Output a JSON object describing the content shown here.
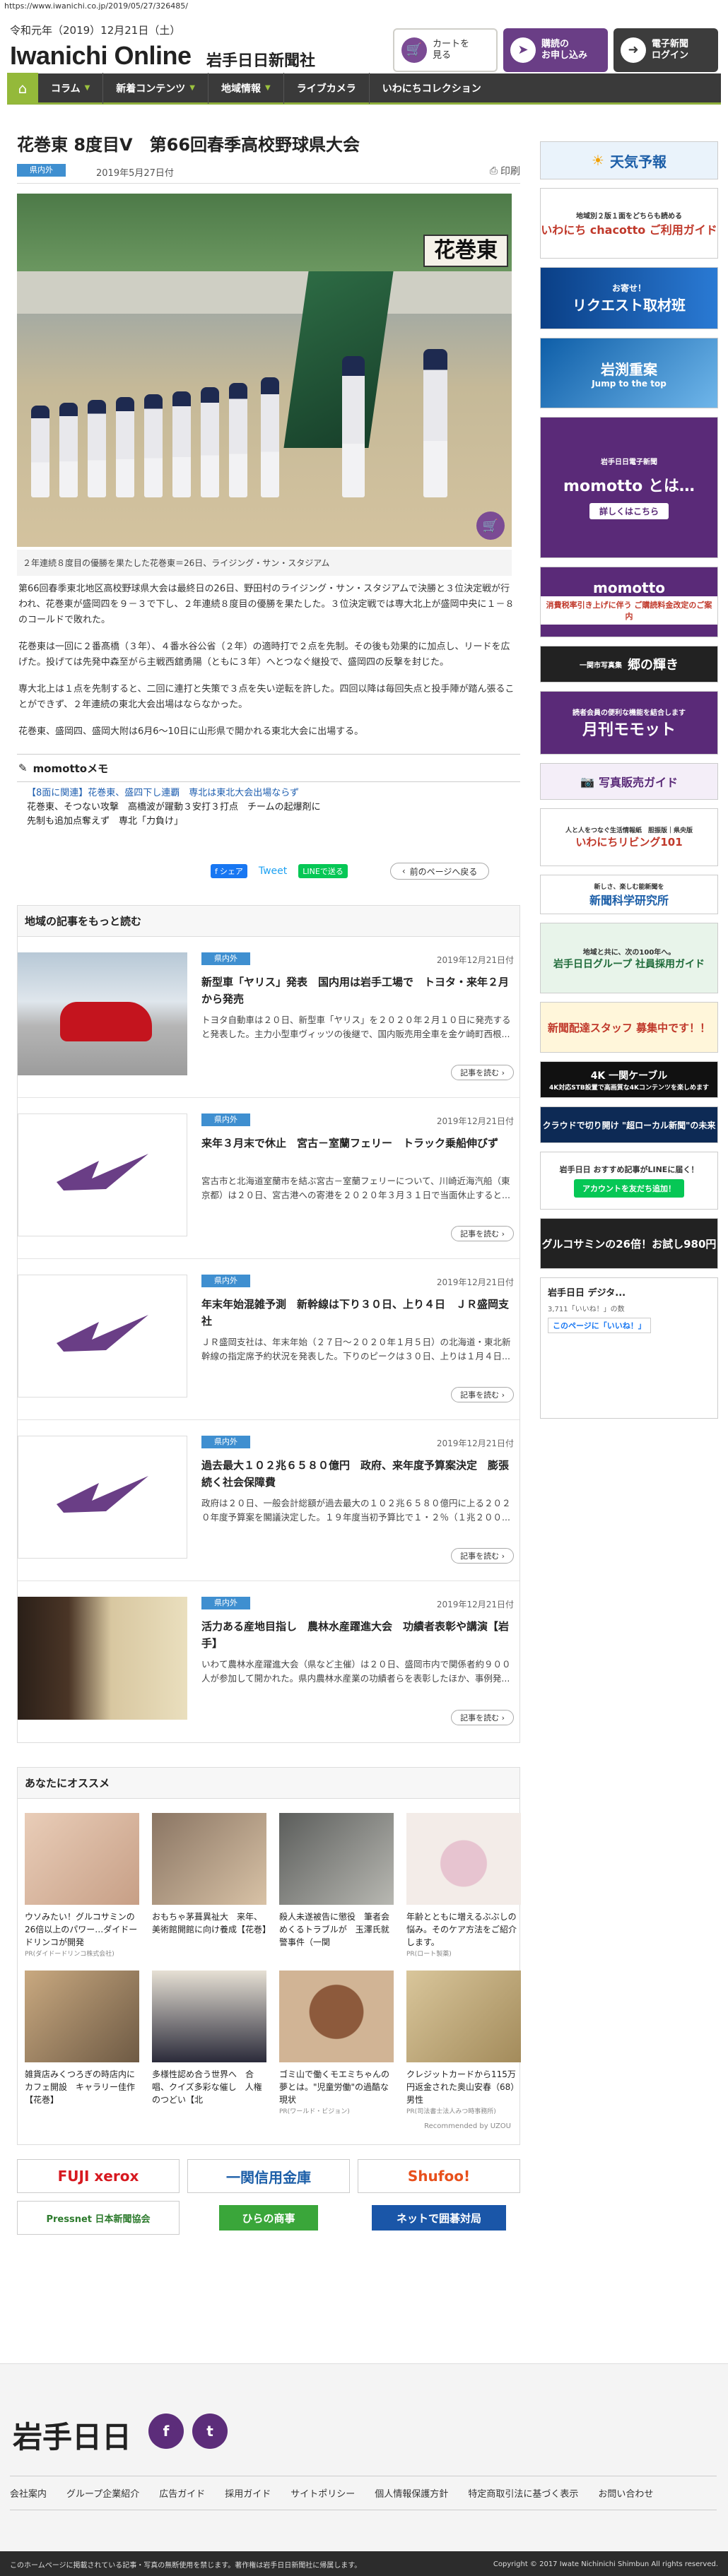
{
  "url": "https://www.iwanichi.co.jp/2019/05/27/326485/",
  "header": {
    "date": "令和元年（2019）12月21日（土）",
    "site_name": "Iwanichi Online",
    "site_sub": "岩手日日新聞社",
    "cart_label": "カートを\n見る",
    "subscribe_label": "購読の\nお申し込み",
    "epaper_label": "電子新聞\nログイン"
  },
  "nav": [
    "コラム",
    "新着コンテンツ",
    "地域情報",
    "ライブカメラ",
    "いわにちコレクション"
  ],
  "article": {
    "title": "花巻東 8度目V　第66回春季高校野球県大会",
    "category": "県内外",
    "published": "2019年5月27日付",
    "print_label": "印刷",
    "photo_sign": "花巻東",
    "caption": "２年連続８度目の優勝を果たした花巻東＝26日、ライジング・サン・スタジアム",
    "paragraphs": [
      "第66回春季東北地区高校野球県大会は最終日の26日、野田村のライジング・サン・スタジアムで決勝と３位決定戦が行われ、花巻東が盛岡四を９－３で下し、２年連続８度目の優勝を果たした。３位決定戦では専大北上が盛岡中央に１－８のコールドで敗れた。",
      "花巻東は一回に２番髙橋（３年）、４番水谷公省（２年）の適時打で２点を先制。その後も効果的に加点し、リードを広げた。投げては先発中森至がら主戦西舘勇陽（ともに３年）へとつなぐ継投で、盛岡四の反撃を封じた。",
      "専大北上は１点を先制すると、二回に連打と失策で３点を失い逆転を許した。四回以降は毎回失点と投手陣が踏ん張ることができず、２年連続の東北大会出場はならなかった。",
      "花巻東、盛岡四、盛岡大附は6月6～10日に山形県で開かれる東北大会に出場する。"
    ]
  },
  "memo": {
    "title": "momottoメモ",
    "lines": [
      "【8面に関連】花巻東、盛四下し連覇　専北は東北大会出場ならず",
      "花巻東、そつない攻撃　高橋波が躍動３安打３打点　チームの起爆剤に",
      "先制も追加点奪えず　専北「力負け」"
    ]
  },
  "share": {
    "facebook": "シェア",
    "twitter": "Tweet",
    "line": "LINEで送る",
    "back": "前のページへ戻る"
  },
  "local_news": {
    "heading": "地域の記事をもっと読む",
    "more_label": "記事を読む",
    "items": [
      {
        "tag": "県内外",
        "date": "2019年12月21日付",
        "title": "新型車「ヤリス」発表　国内用は岩手工場で　トヨタ・来年２月から発売",
        "summary": "トヨタ自動車は２０日、新型車「ヤリス」を２０２０年２月１０日に発売すると発表した。主力小型車ヴィッツの後継で、国内販売用全車を金ケ崎町西根..."
      },
      {
        "tag": "県内外",
        "date": "2019年12月21日付",
        "title": "来年３月末で休止　宮古－室蘭フェリー　トラック乗船伸びず",
        "summary": "宮古市と北海道室蘭市を結ぶ宮古－室蘭フェリーについて、川崎近海汽船（東京都）は２０日、宮古港への寄港を２０２０年３月３１日で当面休止すると..."
      },
      {
        "tag": "県内外",
        "date": "2019年12月21日付",
        "title": "年末年始混雑予測　新幹線は下り３０日、上り４日　ＪＲ盛岡支社",
        "summary": "ＪＲ盛岡支社は、年末年始（２７日～２０２０年１月５日）の北海道・東北新幹線の指定席予約状況を発表した。下りのピークは３０日、上りは１月４日..."
      },
      {
        "tag": "県内外",
        "date": "2019年12月21日付",
        "title": "過去最大１０２兆６５８０億円　政府、来年度予算案決定　膨張続く社会保障費",
        "summary": "政府は２０日、一般会計総額が過去最大の１０２兆６５８０億円に上る２０２０年度予算案を閣議決定した。１９年度当初予算比で１・２％（１兆２００..."
      },
      {
        "tag": "県内外",
        "date": "2019年12月21日付",
        "title": "活力ある産地目指し　農林水産躍進大会　功績者表彰や講演【岩手】",
        "summary": "いわて農林水産躍進大会（県など主催）は２０日、盛岡市内で関係者約９００人が参加して開かれた。県内農林水産業の功績者らを表彰したほか、事例発..."
      }
    ]
  },
  "recommend": {
    "heading": "あなたにオススメ",
    "by": "Recommended by UZOU",
    "items": [
      {
        "title": "ウソみたい！グルコサミンの26倍以上のパワー…ダイドードリンコが開発",
        "pr": "PR(ダイドードリンコ株式会社)"
      },
      {
        "title": "おもちゃ茅葺異祉大　来年、美術館開館に向け養成【花巻】",
        "pr": ""
      },
      {
        "title": "殺人未遂被告に懲役　筆者会めくるトラブルが　玉澤氏就警事件（一関",
        "pr": ""
      },
      {
        "title": "年齢とともに増えるぶぶしの悩み。そのケア方法をご紹介します。",
        "pr": "PR(ロート製薬)"
      },
      {
        "title": "雑貨店みくつろぎの時店内にカフェ開設　キャラリー佳作【花巻】",
        "pr": ""
      },
      {
        "title": "多様性認め合う世界へ　合唱、クイズ多彩な催し　人権のつどい【北",
        "pr": ""
      },
      {
        "title": "ゴミ山で働くモエミちゃんの夢とは。\"児童労働\"の過酷な現状",
        "pr": "PR(ワールド・ビジョン)"
      },
      {
        "title": "クレジットカードから115万円返金された奥山安春（68）男性",
        "pr": "PR(司法書士法人みつ時事務所)"
      }
    ]
  },
  "banners": [
    "FUJI xerox",
    "一関信用金庫",
    "Shufoo!",
    "Pressnet 日本新聞協会",
    "ひらの商事",
    "ネットで囲碁対局"
  ],
  "sidebar": [
    {
      "text": "天気予報",
      "sub": ""
    },
    {
      "text": "いわにち chacotto ご利用ガイド",
      "sub": "地域別２版１面をどちらも読める"
    },
    {
      "text": "リクエスト取材班",
      "sub": "お寄せ！"
    },
    {
      "text": "岩渕重案",
      "sub": "Jump to the top"
    },
    {
      "text": "momotto とは…",
      "sub": "岩手日日電子新聞"
    },
    {
      "text": "詳しくはこちら",
      "sub": ""
    },
    {
      "text": "momotto",
      "sub": "消費税率引き上げに伴う ご購読料金改定のご案内"
    },
    {
      "text": "郷の輝き",
      "sub": "一関市写真集"
    },
    {
      "text": "月刊モモット",
      "sub": "読者会員の便利な機能を結合します"
    },
    {
      "text": "写真販売ガイド",
      "sub": ""
    },
    {
      "text": "いわにちリビング101",
      "sub": "人と人をつなぐ生活情報紙　胆振版｜県央版"
    },
    {
      "text": "新聞科学研究所",
      "sub": "新しさ、楽しむ能新聞を"
    },
    {
      "text": "岩手日日グループ 社員採用ガイド",
      "sub": "地域と共に、次の100年へ。"
    },
    {
      "text": "新聞配達スタッフ 募集中です！！",
      "sub": ""
    },
    {
      "text": "4K 一関ケーブル",
      "sub": "4K対応STB設置で高画質な4Kコンテンツを楽しめます"
    },
    {
      "text": "クラウドで切り開け \"超ローカル新聞\"の未来",
      "sub": ""
    },
    {
      "text": "岩手日日 おすすめ記事がLINEに届く！",
      "sub": "アカウントを友だち追加！"
    },
    {
      "text": "グルコサミンの26倍！お試し980円",
      "sub": ""
    },
    {
      "text": "岩手日日 デジタ...",
      "sub": "3,711「いいね！」の数"
    },
    {
      "text": "このページに「いいね！」",
      "sub": ""
    }
  ],
  "footer": {
    "logo": "岩手日日",
    "links": [
      "会社案内",
      "グループ企業紹介",
      "広告ガイド",
      "採用ガイド",
      "サイトポリシー",
      "個人情報保護方針",
      "特定商取引法に基づく表示",
      "お問い合わせ"
    ],
    "note": "このホームページに掲載されている記事・写真の無断使用を禁じます。著作権は岩手日日新聞社に帰属します。",
    "copyright": "Copyright © 2017 Iwate Nichinichi Shimbun All rights reserved."
  }
}
